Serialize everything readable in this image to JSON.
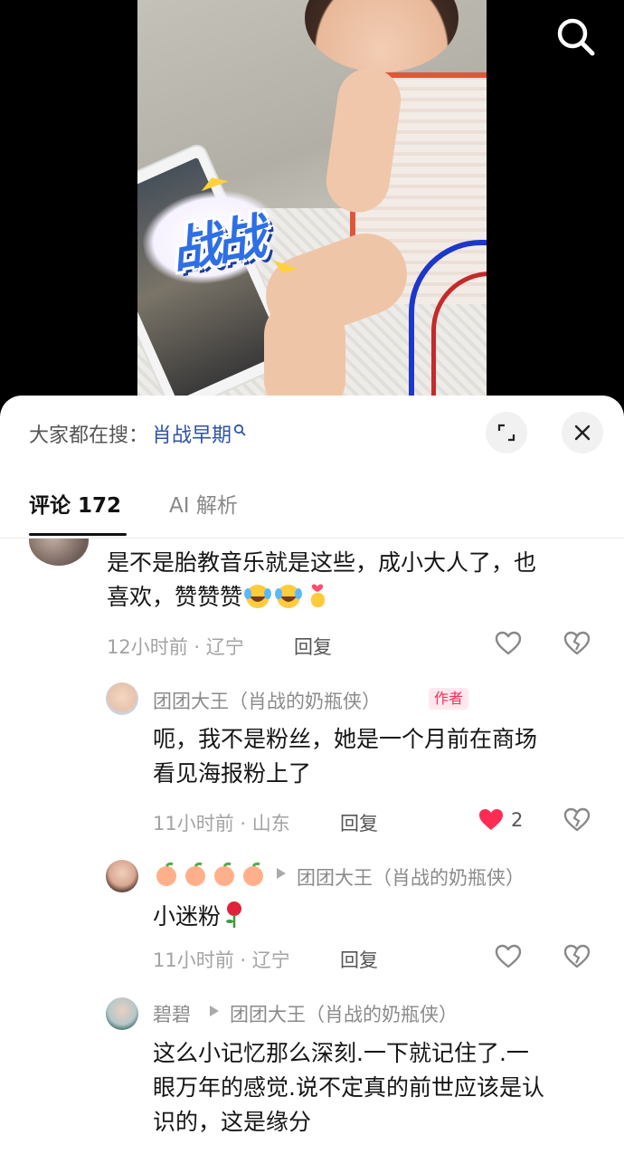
{
  "video": {
    "sticker_text": "战战"
  },
  "sheet": {
    "search_prefix": "大家都在搜：",
    "search_keyword": "肖战早期"
  },
  "tabs": [
    {
      "label": "评论 172"
    },
    {
      "label": "AI 解析"
    }
  ],
  "comments": [
    {
      "text_line1": "是不是胎教音乐就是这些，成小大人了，也",
      "text_line2": "喜欢，赞赞赞",
      "time_location": "12小时前 · 辽宁",
      "reply_label": "回复"
    },
    {
      "username": "团团大王（肖战的奶瓶侠）",
      "badge": "作者",
      "text_line1": "呃，我不是粉丝，她是一个月前在商场",
      "text_line2": "看见海报粉上了",
      "time_location": "11小时前 · 山东",
      "reply_label": "回复",
      "like_count": "2"
    },
    {
      "reply_to": "团团大王（肖战的奶瓶侠）",
      "text_line1": "小迷粉",
      "time_location": "11小时前 · 辽宁",
      "reply_label": "回复"
    },
    {
      "username": "碧碧",
      "reply_to": "团团大王（肖战的奶瓶侠）",
      "text_line1": "这么小记忆那么深刻.一下就记住了.一",
      "text_line2": "眼万年的感觉.说不定真的前世应该是认",
      "text_line3": "识的，这是缘分"
    }
  ],
  "colors": {
    "accent_red": "#fe2c55",
    "link_blue": "#2f53a6"
  }
}
